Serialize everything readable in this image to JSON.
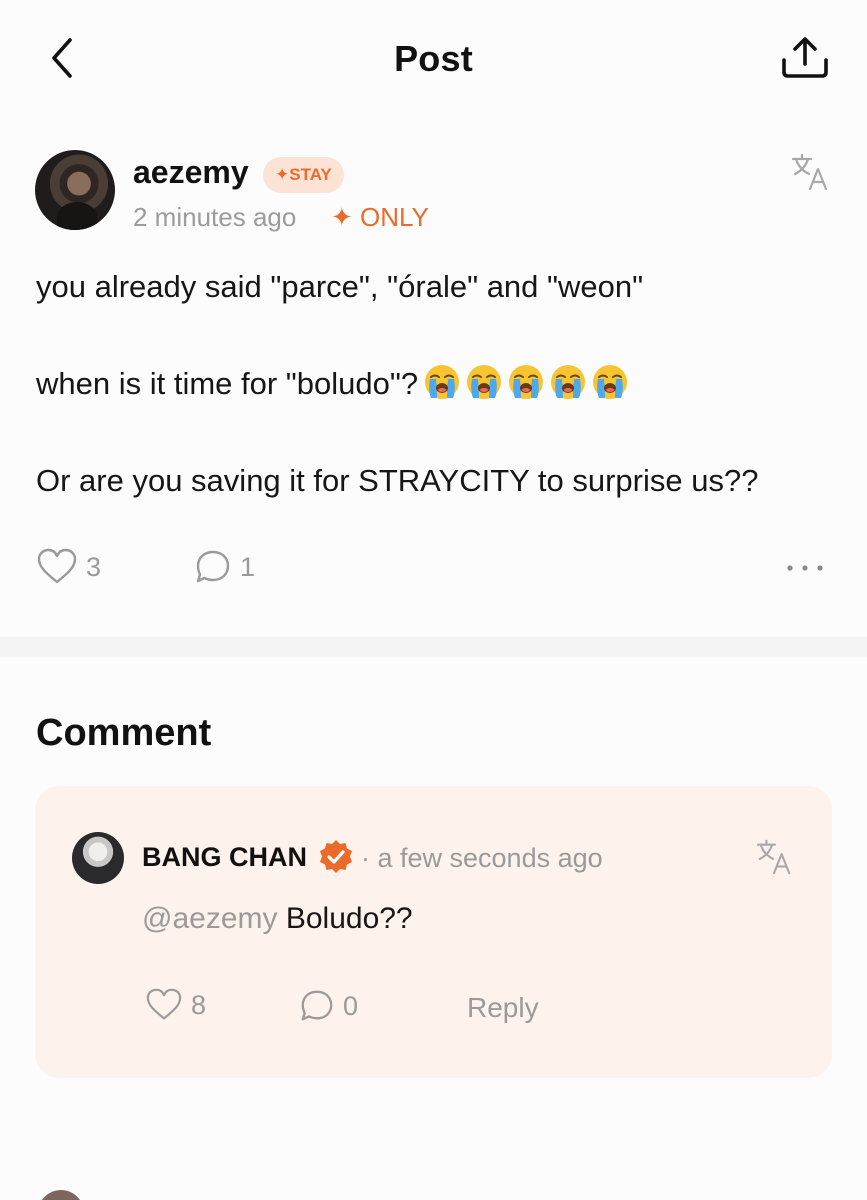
{
  "header": {
    "title": "Post"
  },
  "post": {
    "author": "aezemy",
    "membership_badge": "✦STAY",
    "timestamp": "2 minutes ago",
    "visibility": "✦ ONLY",
    "lines": [
      "you already said \"parce\", \"órale\" and \"weon\"",
      "when is it time for \"boludo\"?",
      "Or are you saving it for STRAYCITY to surprise us??"
    ],
    "emojis": [
      "loudly-crying-face",
      "loudly-crying-face",
      "loudly-crying-face",
      "loudly-crying-face",
      "loudly-crying-face"
    ],
    "likes": "3",
    "comments": "1"
  },
  "comments_section": {
    "heading": "Comment",
    "items": [
      {
        "author": "BANG CHAN",
        "time": "· a few seconds ago",
        "mention": "@aezemy",
        "text": " Boludo??",
        "likes": "8",
        "replies": "0",
        "reply_label": "Reply"
      }
    ]
  },
  "colors": {
    "accent": "#ec6a2a",
    "badge_bg": "#fde3d6",
    "comment_card_bg": "#fdf2ec",
    "muted_text": "#9a9a9a"
  }
}
